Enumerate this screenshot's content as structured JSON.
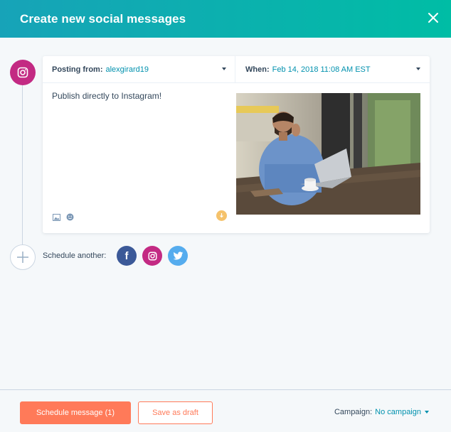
{
  "header": {
    "title": "Create new social messages",
    "close_icon": "close-icon"
  },
  "post": {
    "network_icon": "instagram-icon",
    "posting_from_label": "Posting from:",
    "posting_from_value": "alexgirard19",
    "when_label": "When:",
    "when_value": "Feb 14, 2018 11:08 AM EST",
    "message": "Publish directly to Instagram!",
    "toolbar_icons": [
      "image-icon",
      "emoji-icon"
    ]
  },
  "schedule_another": {
    "label": "Schedule another:",
    "networks": [
      {
        "name": "facebook",
        "color": "#3b5998",
        "glyph": "f"
      },
      {
        "name": "instagram",
        "color": "#c32a83",
        "glyph": ""
      },
      {
        "name": "twitter",
        "color": "#55acee",
        "glyph": ""
      }
    ]
  },
  "footer": {
    "schedule_label": "Schedule message (1)",
    "draft_label": "Save as draft",
    "campaign_label": "Campaign:",
    "campaign_value": "No campaign"
  },
  "colors": {
    "accent": "#ff7a59",
    "link": "#0091ae",
    "header_start": "#17a3b8",
    "header_end": "#00bda5",
    "instagram": "#c32a83"
  }
}
